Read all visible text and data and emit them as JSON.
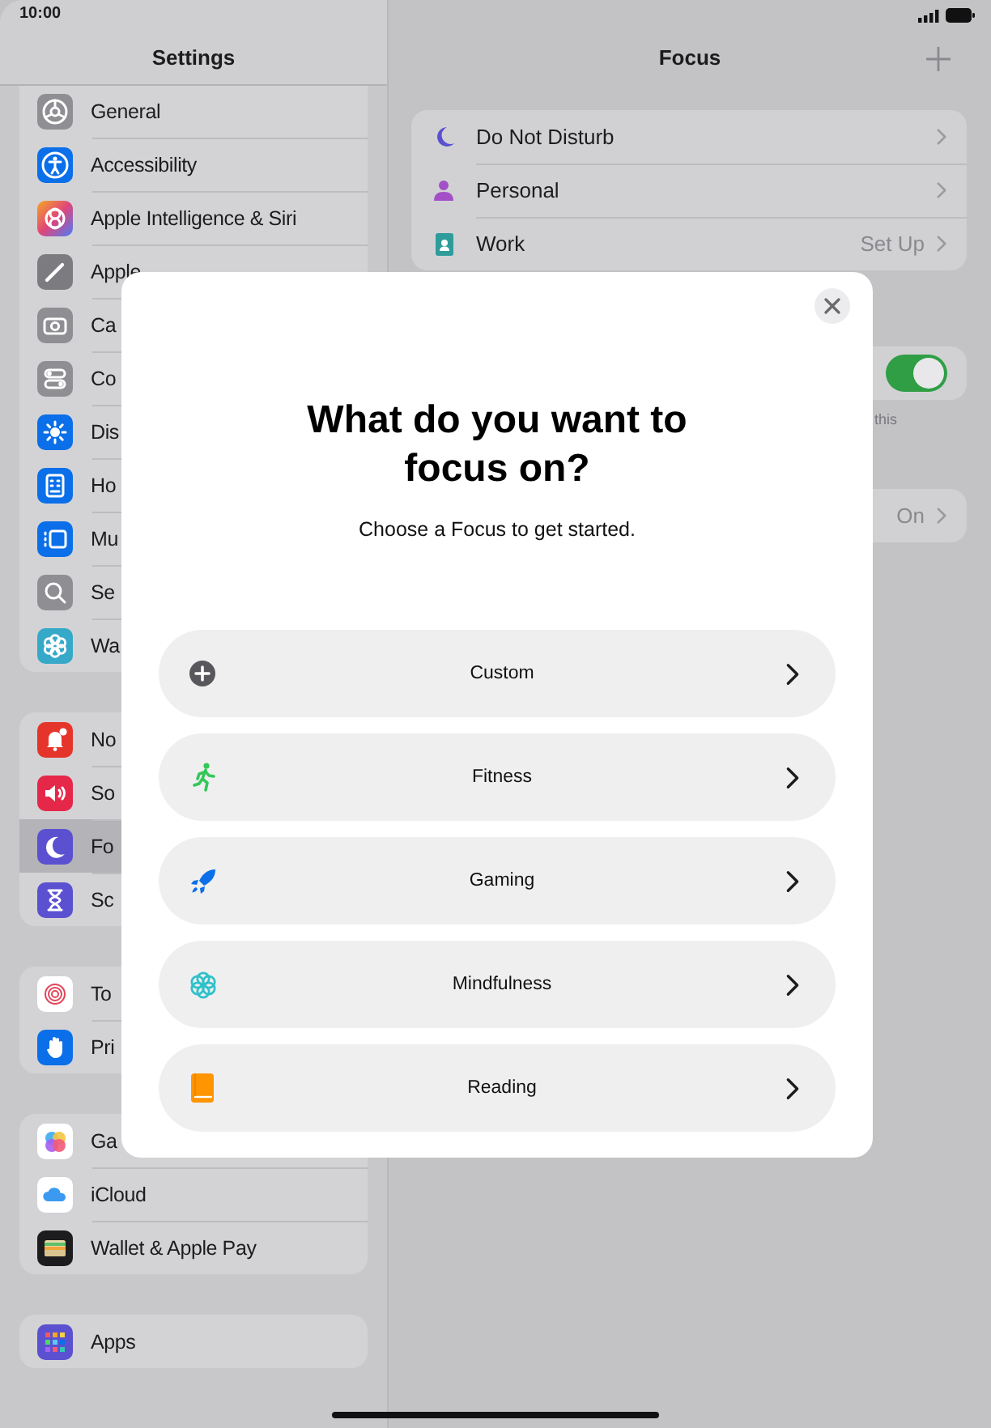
{
  "status_bar": {
    "time": "10:00"
  },
  "sidebar": {
    "title": "Settings",
    "groups": [
      {
        "items": [
          {
            "label": "General",
            "selected": false
          },
          {
            "label": "Accessibility",
            "selected": false
          },
          {
            "label": "Apple Intelligence & Siri",
            "selected": false
          },
          {
            "label": "Apple",
            "selected": false
          },
          {
            "label": "Ca",
            "selected": false
          },
          {
            "label": "Co",
            "selected": false
          },
          {
            "label": "Dis",
            "selected": false
          },
          {
            "label": "Ho",
            "selected": false
          },
          {
            "label": "Mu",
            "selected": false
          },
          {
            "label": "Se",
            "selected": false
          },
          {
            "label": "Wa",
            "selected": false
          }
        ]
      },
      {
        "items": [
          {
            "label": "No",
            "selected": false
          },
          {
            "label": "So",
            "selected": false
          },
          {
            "label": "Fo",
            "selected": true
          },
          {
            "label": "Sc",
            "selected": false
          }
        ]
      },
      {
        "items": [
          {
            "label": "To",
            "selected": false
          },
          {
            "label": "Pri",
            "selected": false
          }
        ]
      },
      {
        "items": [
          {
            "label": "Ga",
            "selected": false
          },
          {
            "label": "iCloud",
            "selected": false
          },
          {
            "label": "Wallet & Apple Pay",
            "selected": false
          }
        ]
      },
      {
        "items": [
          {
            "label": "Apps",
            "selected": false
          }
        ]
      }
    ]
  },
  "focus": {
    "title": "Focus",
    "modes": [
      {
        "label": "Do Not Disturb"
      },
      {
        "label": "Personal"
      },
      {
        "label": "Work",
        "value": "Set Up"
      }
    ],
    "share_card": {
      "on": true
    },
    "caption": "this",
    "status_card": {
      "value": "On"
    }
  },
  "sheet": {
    "title": "What do you want to focus on?",
    "subtitle": "Choose a Focus to get started.",
    "options": [
      {
        "label": "Custom"
      },
      {
        "label": "Fitness"
      },
      {
        "label": "Gaming"
      },
      {
        "label": "Mindfulness"
      },
      {
        "label": "Reading"
      }
    ]
  }
}
